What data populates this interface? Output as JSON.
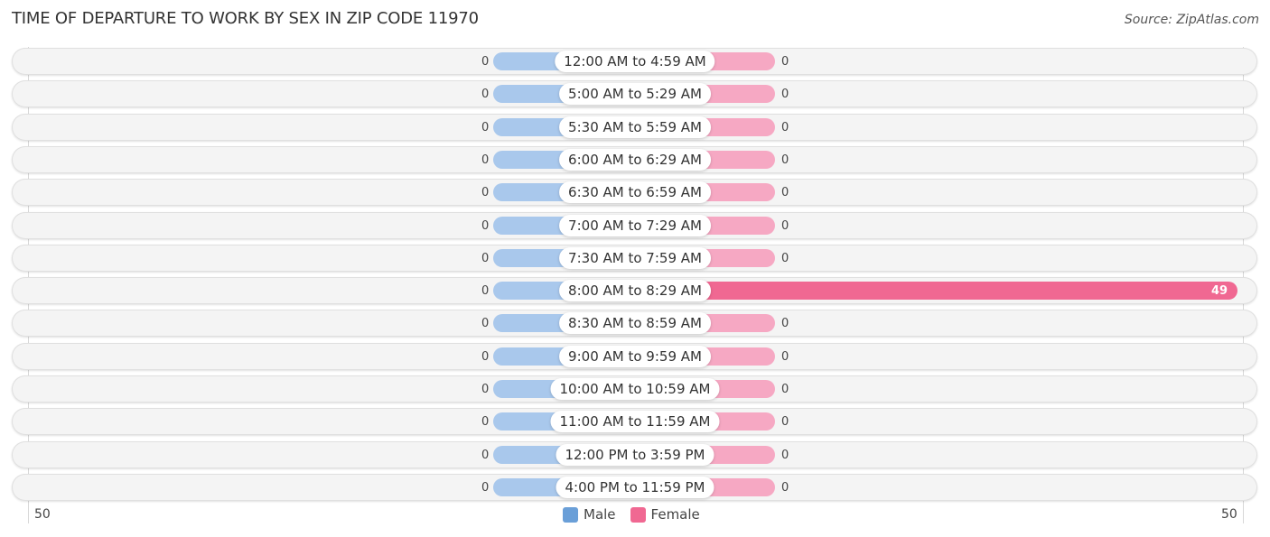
{
  "header": {
    "title": "TIME OF DEPARTURE TO WORK BY SEX IN ZIP CODE 11970",
    "source": "Source: ZipAtlas.com"
  },
  "colors": {
    "male": "#a9c8ec",
    "female": "#f6a8c3",
    "female_highlight": "#f06892",
    "legend_male": "#6a9fd8",
    "legend_female": "#f06892"
  },
  "legend": [
    {
      "label": "Male",
      "color": "#6a9fd8"
    },
    {
      "label": "Female",
      "color": "#f06892"
    }
  ],
  "axis": {
    "left_tick": "50",
    "right_tick": "50"
  },
  "chart_data": {
    "type": "bar",
    "orientation": "horizontal-diverging",
    "title": "TIME OF DEPARTURE TO WORK BY SEX IN ZIP CODE 11970",
    "xlabel": "",
    "ylabel": "",
    "xlim": [
      -50,
      50
    ],
    "legend_position": "bottom-center",
    "categories": [
      "12:00 AM to 4:59 AM",
      "5:00 AM to 5:29 AM",
      "5:30 AM to 5:59 AM",
      "6:00 AM to 6:29 AM",
      "6:30 AM to 6:59 AM",
      "7:00 AM to 7:29 AM",
      "7:30 AM to 7:59 AM",
      "8:00 AM to 8:29 AM",
      "8:30 AM to 8:59 AM",
      "9:00 AM to 9:59 AM",
      "10:00 AM to 10:59 AM",
      "11:00 AM to 11:59 AM",
      "12:00 PM to 3:59 PM",
      "4:00 PM to 11:59 PM"
    ],
    "series": [
      {
        "name": "Male",
        "values": [
          0,
          0,
          0,
          0,
          0,
          0,
          0,
          0,
          0,
          0,
          0,
          0,
          0,
          0
        ]
      },
      {
        "name": "Female",
        "values": [
          0,
          0,
          0,
          0,
          0,
          0,
          0,
          49,
          0,
          0,
          0,
          0,
          0,
          0
        ]
      }
    ]
  }
}
